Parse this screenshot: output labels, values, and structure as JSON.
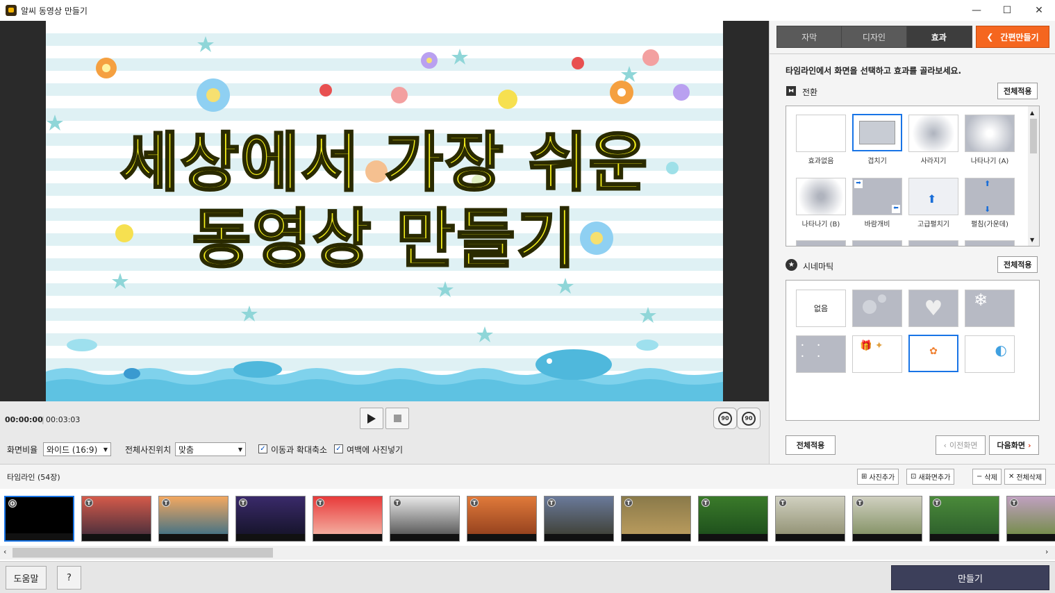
{
  "window": {
    "title": "알씨 동영상 만들기",
    "minimize": "—",
    "maximize": "☐",
    "close": "✕"
  },
  "preview": {
    "title_line1": "세상에서 가장 쉬운",
    "title_line2": "동영상 만들기"
  },
  "playback": {
    "current_time": "00:00:00",
    "total_time": "00:03:03",
    "rotate_left": "90",
    "rotate_right": "90"
  },
  "settings": {
    "aspect_label": "화면비율",
    "aspect_value": "와이드 (16:9)",
    "photo_pos_label": "전체사진위치",
    "photo_pos_value": "맞춤",
    "zoom_label": "이동과 확대축소",
    "zoom_checked": true,
    "fill_label": "여백에 사진넣기",
    "fill_checked": true
  },
  "tabs": [
    {
      "label": "자막"
    },
    {
      "label": "디자인"
    },
    {
      "label": "효과",
      "active": true
    }
  ],
  "quick_button": "간편만들기",
  "effects": {
    "instruction": "타임라인에서 화면을 선택하고 효과를 골라보세요.",
    "transition_title": "전환",
    "transition_apply_all": "전체적용",
    "transitions": [
      {
        "label": "효과없음"
      },
      {
        "label": "겹치기",
        "selected": true
      },
      {
        "label": "사라지기"
      },
      {
        "label": "나타나기 (A)"
      },
      {
        "label": "나타나기 (B)"
      },
      {
        "label": "바람개비"
      },
      {
        "label": "고급펼치기"
      },
      {
        "label": "펼침(가운데)"
      }
    ],
    "cinematic_title": "시네마틱",
    "cinematic_apply_all": "전체적용",
    "cinematic_none": "없음",
    "apply_all": "전체적용",
    "prev_screen": "이전화면",
    "next_screen": "다음화면"
  },
  "timeline": {
    "label": "타임라인 (54장)",
    "add_photo": "사진추가",
    "add_new_screen": "새화면추가",
    "delete": "삭제",
    "delete_all": "전체삭제",
    "frames": [
      {
        "badge": "O",
        "colors": [
          "#000000",
          "#000000"
        ]
      },
      {
        "badge": "T",
        "colors": [
          "#d45a4a",
          "#3a2a3a"
        ]
      },
      {
        "badge": "T",
        "colors": [
          "#f3a860",
          "#2a6a8a"
        ]
      },
      {
        "badge": "T",
        "colors": [
          "#3a2a6a",
          "#111122"
        ]
      },
      {
        "badge": "T",
        "colors": [
          "#e83a3a",
          "#f6c0b0"
        ]
      },
      {
        "badge": "T",
        "colors": [
          "#e8e8e8",
          "#444444"
        ]
      },
      {
        "badge": "T",
        "colors": [
          "#e07a3a",
          "#8a3a1a"
        ]
      },
      {
        "badge": "T",
        "colors": [
          "#6a7a9a",
          "#3a3a2a"
        ]
      },
      {
        "badge": "T",
        "colors": [
          "#8a7a4a",
          "#c0a060"
        ]
      },
      {
        "badge": "T",
        "colors": [
          "#3a7a2a",
          "#1a4a1a"
        ]
      },
      {
        "badge": "T",
        "colors": [
          "#d0d0c0",
          "#8a8a6a"
        ]
      },
      {
        "badge": "T",
        "colors": [
          "#d0d0c0",
          "#7a8a5a"
        ]
      },
      {
        "badge": "T",
        "colors": [
          "#4a8a3a",
          "#2a5a2a"
        ]
      },
      {
        "badge": "T",
        "colors": [
          "#c0a0c0",
          "#6a8a3a"
        ]
      }
    ]
  },
  "bottom": {
    "help": "도움말",
    "question": "?",
    "make": "만들기"
  }
}
